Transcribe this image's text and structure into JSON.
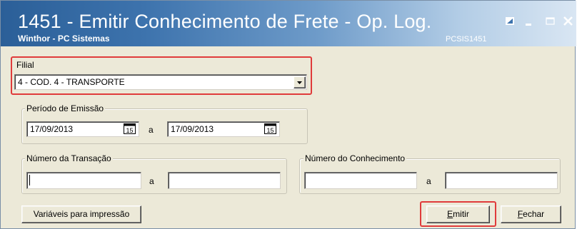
{
  "window": {
    "title": "1451 - Emitir Conhecimento de Frete - Op. Log.",
    "subtitle": "Winthor - PC Sistemas",
    "code": "PCSIS1451"
  },
  "filial": {
    "label": "Filial",
    "value": "4 - COD. 4 - TRANSPORTE"
  },
  "periodo": {
    "title": "Período de Emissão",
    "start": "17/09/2013",
    "separator": "a",
    "end": "17/09/2013",
    "calendar_glyph": "15"
  },
  "transacao": {
    "title": "Número da Transação",
    "start": "",
    "separator": "a",
    "end": ""
  },
  "conhecimento": {
    "title": "Número do Conhecimento",
    "start": "",
    "separator": "a",
    "end": ""
  },
  "buttons": {
    "variaveis": "Variáveis para impressão",
    "emitir_first": "E",
    "emitir_rest": "mitir",
    "fechar_first": "F",
    "fechar_rest": "echar"
  },
  "colors": {
    "highlight": "#e03b3b",
    "titlebar_start": "#2b5f98",
    "titlebar_end": "#d9e6f3",
    "form_bg": "#ece9d8"
  },
  "icons": [
    "restore-icon",
    "minimize-icon",
    "maximize-icon",
    "close-icon",
    "dropdown-arrow-icon",
    "calendar-icon"
  ]
}
